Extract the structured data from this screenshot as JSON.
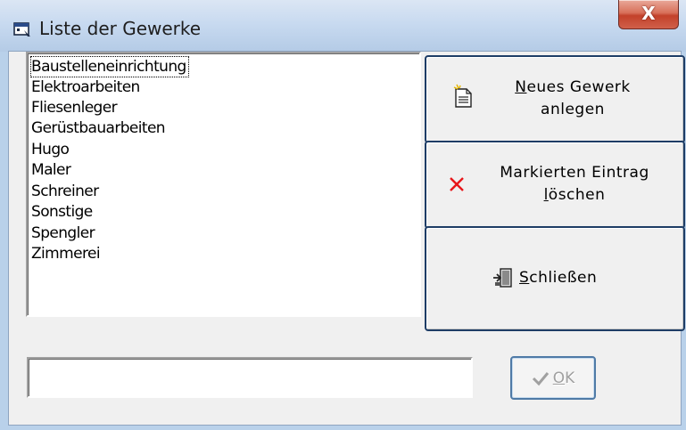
{
  "window": {
    "title": "Liste der Gewerke",
    "title_icon": "form-window-icon",
    "close_label": "X"
  },
  "list": {
    "items": [
      "Baustelleneinrichtung",
      "Elektroarbeiten",
      "Fliesenleger",
      "Gerüstbauarbeiten",
      "Hugo",
      "Maler",
      "Schreiner",
      "Sonstige",
      "Spengler",
      "Zimmerei"
    ],
    "focused_index": 0
  },
  "buttons": {
    "new": {
      "accel": "N",
      "line1_rest": "eues Gewerk",
      "line2": "anlegen",
      "icon": "new-document-icon"
    },
    "delete": {
      "line1": "Markierten Eintrag",
      "accel": "l",
      "line2_rest": "öschen",
      "icon": "delete-x-icon",
      "icon_color": "#e8161a"
    },
    "close": {
      "accel": "S",
      "rest": "chließen",
      "icon": "exit-door-icon"
    }
  },
  "input": {
    "value": ""
  },
  "ok": {
    "accel": "O",
    "rest": "K",
    "icon": "check-icon",
    "enabled": false
  },
  "colors": {
    "frame": "#b9d1ea",
    "button_border": "#1e3d66",
    "close_red": "#c3412a"
  }
}
